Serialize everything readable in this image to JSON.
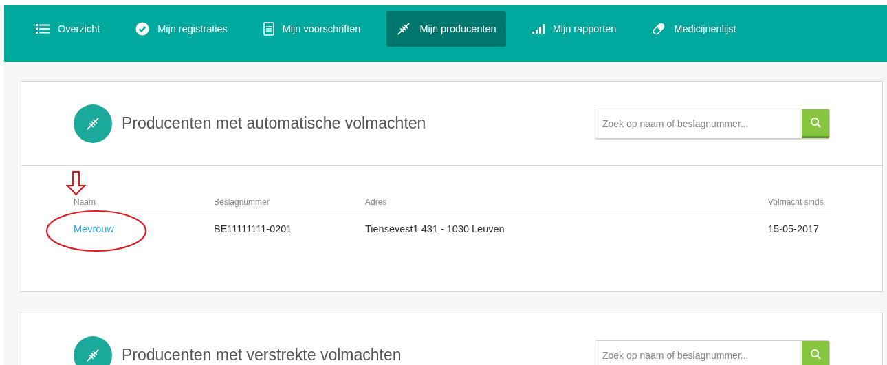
{
  "nav": {
    "tabs": [
      {
        "label": "Overzicht",
        "kind": "list",
        "selected": false
      },
      {
        "label": "Mijn registraties",
        "kind": "check",
        "selected": false
      },
      {
        "label": "Mijn voorschriften",
        "kind": "document",
        "selected": false
      },
      {
        "label": "Mijn producenten",
        "kind": "wheat",
        "selected": true
      },
      {
        "label": "Mijn rapporten",
        "kind": "bars",
        "selected": false
      },
      {
        "label": "Medicijnenlijst",
        "kind": "pill",
        "selected": false
      }
    ]
  },
  "panels": [
    {
      "title": "Producenten met automatische volmachten",
      "search": {
        "placeholder": "Zoek op naam of beslagnummer..."
      },
      "table": {
        "columns": [
          "Naam",
          "Beslagnummer",
          "Adres",
          "Volmacht sinds"
        ],
        "rows": [
          {
            "cells": [
              "Mevrouw",
              "BE11111111-0201",
              "Tiensevest1 431 - 1030 Leuven",
              "15-05-2017"
            ]
          }
        ]
      }
    },
    {
      "title": "Producenten met verstrekte volmachten",
      "search": {
        "placeholder": "Zoek op naam of beslagnummer..."
      }
    }
  ]
}
